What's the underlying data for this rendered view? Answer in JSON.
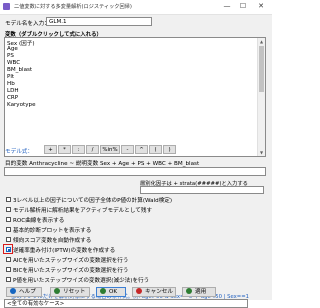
{
  "window": {
    "title": "二値変数に対する多変量解析(ロジスティック回帰)",
    "min": "—",
    "max": "☐",
    "close": "✕"
  },
  "model_name": {
    "label": "モデル名を入力：",
    "value": "GLM.1"
  },
  "variables": {
    "header": "変数（ダブルクリックして式に入れる）",
    "items": [
      "Sex (因子)",
      "Age",
      "PS",
      "WBC",
      "BM_blast",
      "Plt",
      "Hb",
      "LDH",
      "CRP",
      "Karyotype"
    ]
  },
  "formula": {
    "label": "モデル式：",
    "operators": [
      "+",
      "*",
      ":",
      "/",
      "%in%",
      "-",
      "^",
      "(",
      ")"
    ],
    "objective_label": "目的変数 Anthracycline ~ 説明変数 Sex + Age + PS + WBC + BM_blast"
  },
  "strata": {
    "label": "層別化因子は + strata(#####)と入力する"
  },
  "options": [
    {
      "label": "3レベル以上の因子についての因子全体のP値の計算(Wald検定)",
      "checked": false
    },
    {
      "label": "モデル解析用に解析結果をアクティブモデルとして残す",
      "checked": false
    },
    {
      "label": "ROC曲線を表示する",
      "checked": false
    },
    {
      "label": "基本的診断プロットを表示する",
      "checked": false
    },
    {
      "label": "傾向スコア変数を自動作成する",
      "checked": false
    },
    {
      "label": "逆確率重み付け(IPTW)の変数を作成する",
      "checked": true,
      "highlighted": true
    },
    {
      "label": "AICを用いたステップワイズの変数選択を行う",
      "checked": false
    },
    {
      "label": "BICを用いたステップワイズの変数選択を行う",
      "checked": false
    },
    {
      "label": "P値を用いたステップワイズの変数選択(減少法)を行う",
      "checked": false
    }
  ],
  "subset": {
    "label": "一部のサンプルだけを解析対象にする場合の条件式。例: age>50 & Sex==0 や age<50 | Sex==1",
    "value": "<全ての有効なケース>"
  },
  "buttons": {
    "help": "ヘルプ",
    "reset": "リセット",
    "ok": "OK",
    "cancel": "キャンセル",
    "apply": "適用"
  },
  "colors": {
    "accent": "#1565c0",
    "highlight": "#d81b1b",
    "link_blue": "#1f5fbf"
  }
}
